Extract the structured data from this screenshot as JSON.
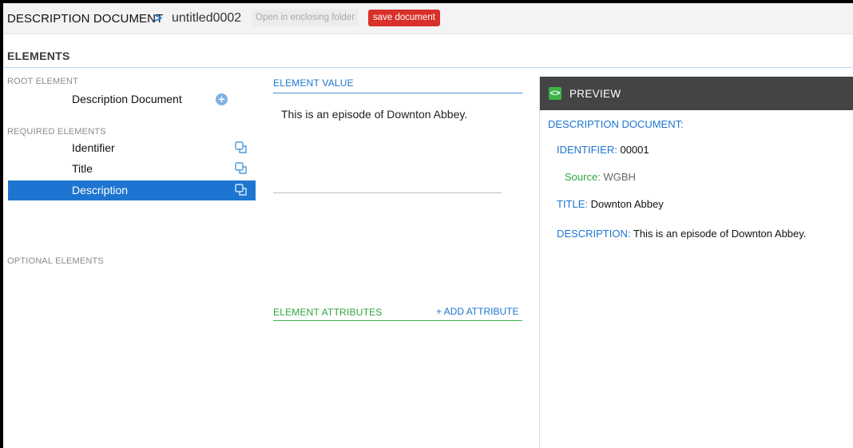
{
  "header": {
    "root_crumb": "DESCRIPTION DOCUMENT",
    "separator": ">",
    "file_name": "untitled0002",
    "open_folder_label": "Open in enclosing folder",
    "save_label": "save document"
  },
  "elements": {
    "title": "ELEMENTS",
    "root_label": "ROOT ELEMENT",
    "root_item": "Description Document",
    "required_label": "REQUIRED ELEMENTS",
    "required_items": [
      "Identifier",
      "Title",
      "Description"
    ],
    "selected_index": 2,
    "optional_label": "OPTIONAL ELEMENTS"
  },
  "element_value": {
    "title": "ELEMENT VALUE",
    "text": "This is an episode of Downton Abbey."
  },
  "element_attributes": {
    "title": "ELEMENT ATTRIBUTES",
    "add_label": "+ ADD ATTRIBUTE"
  },
  "preview": {
    "title": "PREVIEW",
    "icon": "code-icon",
    "doc_label": "DESCRIPTION DOCUMENT:",
    "identifier_key": "IDENTIFIER:",
    "identifier_val": "00001",
    "source_key": "Source:",
    "source_val": "WGBH",
    "title_key": "TITLE:",
    "title_val": "Downton Abbey",
    "description_key": "DESCRIPTION:",
    "description_val": "This is an episode of Downton Abbey."
  },
  "colors": {
    "accent_blue": "#1e75d1",
    "save_red": "#d9302b",
    "attributes_green": "#2fa53b",
    "preview_header": "#444444"
  }
}
